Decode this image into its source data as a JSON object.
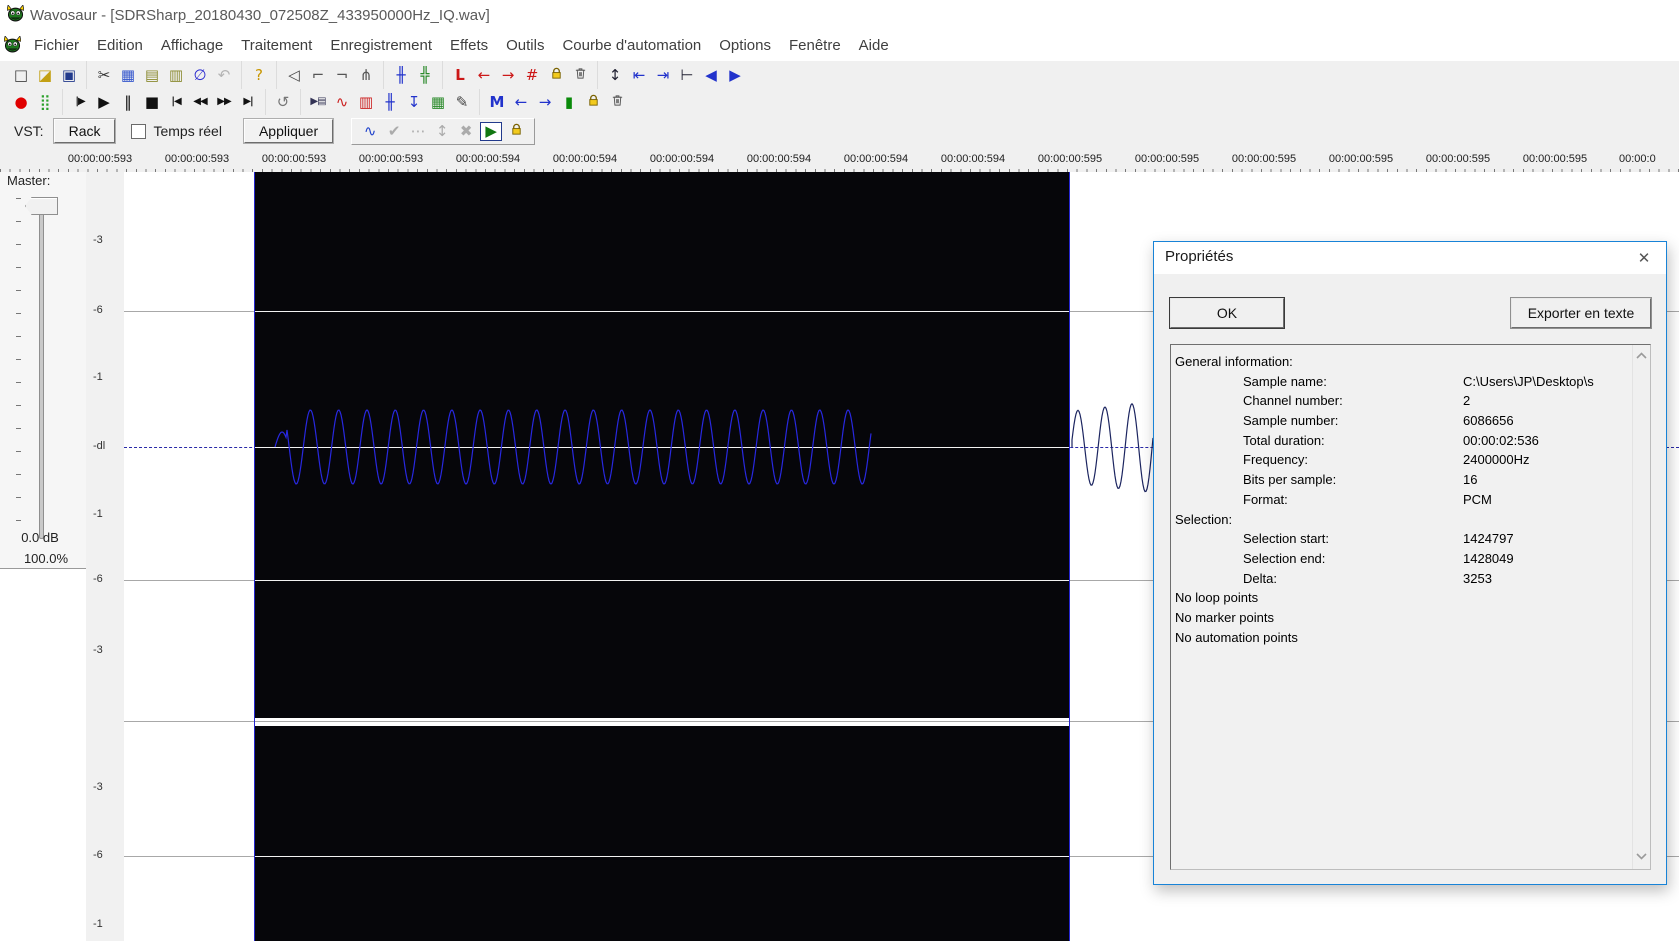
{
  "window": {
    "title": "Wavosaur - [SDRSharp_20180430_072508Z_433950000Hz_IQ.wav]"
  },
  "menus": [
    "Fichier",
    "Edition",
    "Affichage",
    "Traitement",
    "Enregistrement",
    "Effets",
    "Outils",
    "Courbe d'automation",
    "Options",
    "Fenêtre",
    "Aide"
  ],
  "toolbar_file": {
    "groups": [
      [
        "new-file",
        "open-file",
        "save-file"
      ],
      [
        "cut",
        "copy",
        "paste",
        "paste-mix",
        "trim",
        "undo"
      ],
      [
        "help"
      ],
      [
        "monitor",
        "connector-a",
        "connector-b",
        "wrench"
      ],
      [
        "wave-zoom",
        "wave-select"
      ],
      [
        "loop-l",
        "loop-back",
        "loop-forward",
        "loop-clear",
        "loop-lock",
        "loop-delete"
      ],
      [
        "zoom-vertical",
        "expand-left",
        "expand-right",
        "snap-line",
        "prev-view",
        "next-view"
      ]
    ]
  },
  "toolbar_transport": {
    "groups": [
      [
        "record",
        "vu-meter"
      ],
      [
        "play-from-cursor",
        "play",
        "pause",
        "stop",
        "go-start",
        "rewind",
        "fast-forward",
        "go-end"
      ],
      [
        "loop-mode"
      ],
      [
        "paste-insert",
        "analysis",
        "copy-doc",
        "interpolate",
        "resample-down",
        "stats-list",
        "pencil"
      ],
      [
        "marker",
        "marker-prev",
        "marker-next",
        "marker-wave",
        "marker-lock",
        "marker-delete"
      ]
    ]
  },
  "vst_bar": {
    "label": "VST:",
    "rack_button": "Rack",
    "realtime_label": "Temps réel",
    "realtime_checked": false,
    "apply_button": "Appliquer",
    "automation_icons": [
      "automation-curve",
      "automation-apply",
      "automation-points",
      "automation-scale",
      "automation-clear",
      "automation-play",
      "automation-lock"
    ]
  },
  "ruler": {
    "labels": [
      "00:00:00:593",
      "00:00:00:593",
      "00:00:00:593",
      "00:00:00:593",
      "00:00:00:594",
      "00:00:00:594",
      "00:00:00:594",
      "00:00:00:594",
      "00:00:00:594",
      "00:00:00:594",
      "00:00:00:595",
      "00:00:00:595",
      "00:00:00:595",
      "00:00:00:595",
      "00:00:00:595",
      "00:00:00:595"
    ],
    "partial_label": "00:00:0"
  },
  "master": {
    "label": "Master:",
    "gain": "0.0 dB",
    "percent": "100.0%"
  },
  "db_scale": [
    "-3",
    "-6",
    "-1",
    "-dl",
    "-1",
    "-6",
    "-3",
    "-3",
    "-6",
    "-1"
  ],
  "dialog": {
    "title": "Propriétés",
    "close_glyph": "✕",
    "ok_button": "OK",
    "export_button": "Exporter en texte",
    "rows": [
      {
        "label": "General information:",
        "value": "",
        "indent": 0
      },
      {
        "label": "Sample name:",
        "value": "C:\\Users\\JP\\Desktop\\s",
        "indent": 1
      },
      {
        "label": "Channel number:",
        "value": "2",
        "indent": 1
      },
      {
        "label": "Sample number:",
        "value": "6086656",
        "indent": 1
      },
      {
        "label": "Total duration:",
        "value": "00:00:02:536",
        "indent": 1
      },
      {
        "label": "Frequency:",
        "value": "2400000Hz",
        "indent": 1
      },
      {
        "label": "Bits per sample:",
        "value": "16",
        "indent": 1
      },
      {
        "label": "Format:",
        "value": "PCM",
        "indent": 1
      },
      {
        "label": "Selection:",
        "value": "",
        "indent": 0
      },
      {
        "label": "Selection start:",
        "value": "1424797",
        "indent": 1
      },
      {
        "label": "Selection end:",
        "value": "1428049",
        "indent": 1
      },
      {
        "label": "Delta:",
        "value": "3253",
        "indent": 1
      },
      {
        "label": "No loop points",
        "value": "",
        "indent": 0
      },
      {
        "label": "No marker points",
        "value": "",
        "indent": 0
      },
      {
        "label": "No automation points",
        "value": "",
        "indent": 0
      }
    ]
  },
  "colors": {
    "selection_bg": "#06060a",
    "wave_blue": "#2828e0",
    "wave_dark": "#1c2560",
    "dialog_border": "#1883d7",
    "accent_red": "#cc1818"
  }
}
